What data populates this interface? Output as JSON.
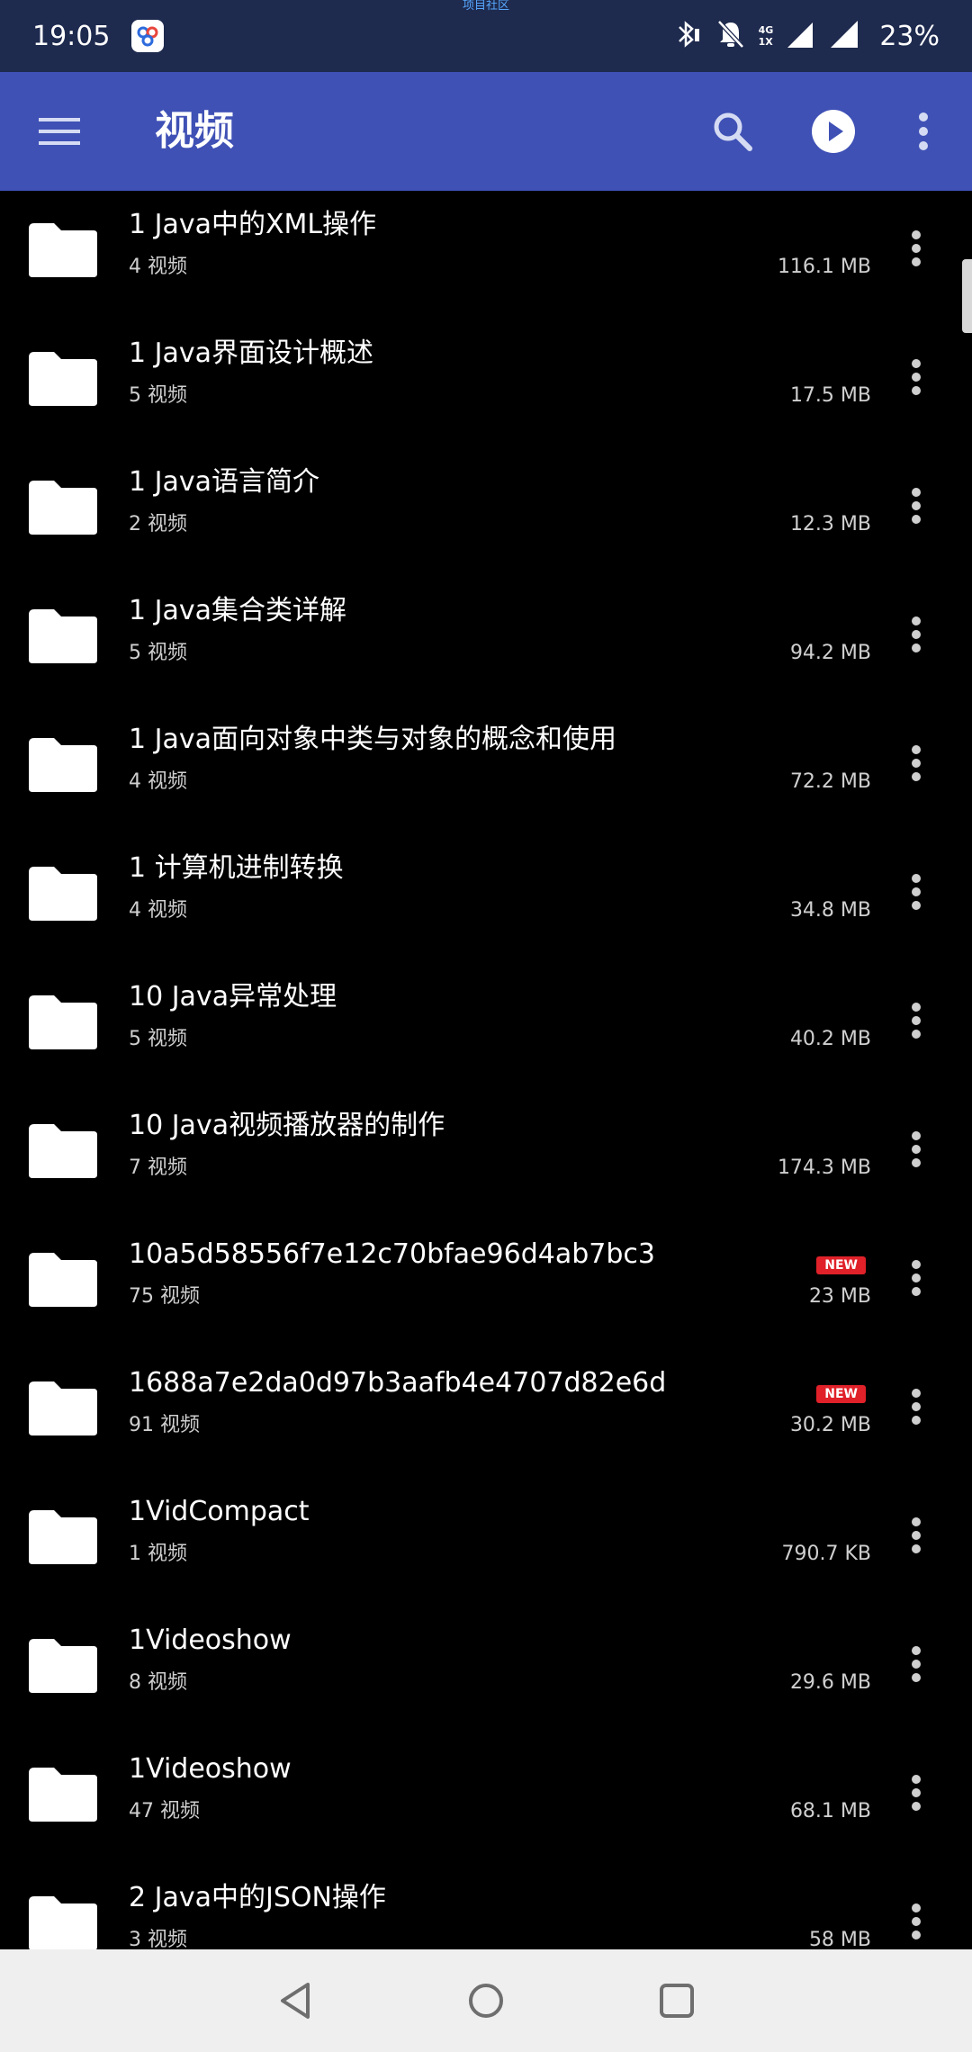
{
  "status_bar": {
    "time": "19:05",
    "notice": "项目社区",
    "network_top": "4G",
    "network_bottom": "1X",
    "battery": "23%"
  },
  "app_bar": {
    "title": "视频"
  },
  "folders": [
    {
      "name": "1 Java中的XML操作",
      "count": "4 视频",
      "size": "116.1 MB",
      "badge": ""
    },
    {
      "name": "1 Java界面设计概述",
      "count": "5 视频",
      "size": "17.5 MB",
      "badge": ""
    },
    {
      "name": "1 Java语言简介",
      "count": "2 视频",
      "size": "12.3 MB",
      "badge": ""
    },
    {
      "name": "1 Java集合类详解",
      "count": "5 视频",
      "size": "94.2 MB",
      "badge": ""
    },
    {
      "name": "1 Java面向对象中类与对象的概念和使用",
      "count": "4 视频",
      "size": "72.2 MB",
      "badge": ""
    },
    {
      "name": "1 计算机进制转换",
      "count": "4 视频",
      "size": "34.8 MB",
      "badge": ""
    },
    {
      "name": "10 Java异常处理",
      "count": "5 视频",
      "size": "40.2 MB",
      "badge": ""
    },
    {
      "name": "10 Java视频播放器的制作",
      "count": "7 视频",
      "size": "174.3 MB",
      "badge": ""
    },
    {
      "name": "10a5d58556f7e12c70bfae96d4ab7bc3",
      "count": "75 视频",
      "size": "23 MB",
      "badge": "NEW"
    },
    {
      "name": "1688a7e2da0d97b3aafb4e4707d82e6d",
      "count": "91 视频",
      "size": "30.2 MB",
      "badge": "NEW"
    },
    {
      "name": "1VidCompact",
      "count": "1 视频",
      "size": "790.7 KB",
      "badge": ""
    },
    {
      "name": "1Videoshow",
      "count": "8 视频",
      "size": "29.6 MB",
      "badge": ""
    },
    {
      "name": "1Videoshow",
      "count": "47 视频",
      "size": "68.1 MB",
      "badge": ""
    },
    {
      "name": "2 Java中的JSON操作",
      "count": "3 视频",
      "size": "58 MB",
      "badge": ""
    }
  ],
  "colors": {
    "status_bar": "#1e2a4e",
    "app_bar": "#3f51b5",
    "background": "#000000",
    "badge": "#e02129",
    "nav_bar": "#efefef"
  },
  "icons": {
    "menu": "hamburger-icon",
    "search": "search-icon",
    "play": "play-circle-icon",
    "overflow": "more-vert-icon",
    "folder": "folder-icon",
    "nav_back": "back-triangle-icon",
    "nav_home": "home-circle-icon",
    "nav_recents": "recents-square-icon"
  }
}
